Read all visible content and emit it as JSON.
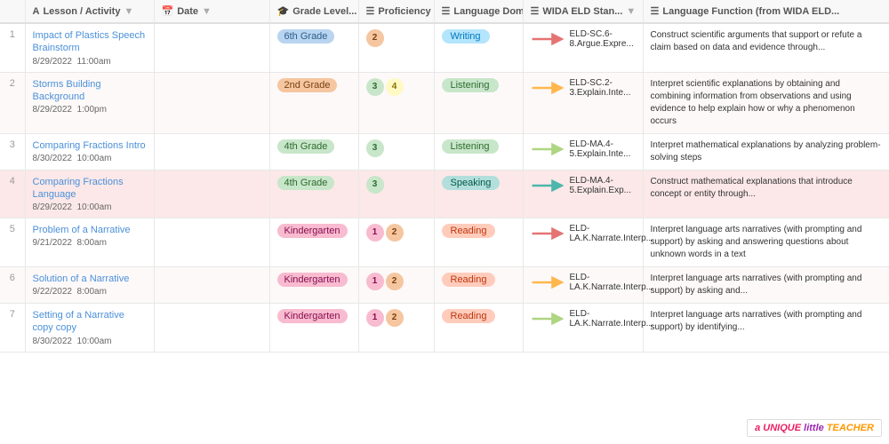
{
  "header": {
    "col_num": "#",
    "col_lesson": "Lesson / Activity",
    "col_date": "Date",
    "col_grade": "Grade Level...",
    "col_prof": "Proficiency Level(s)",
    "col_lang_domain": "Language Domain(s)",
    "col_wida": "WIDA ELD Stan...",
    "col_lang_func": "Language Function (from WIDA ELD..."
  },
  "rows": [
    {
      "num": "1",
      "lesson": "Impact of Plastics Speech Brainstorm",
      "date": "8/29/2022",
      "time": "11:00am",
      "grade": "6th Grade",
      "grade_class": "grade-6th",
      "prof": [
        "2"
      ],
      "prof_classes": [
        "prof-2"
      ],
      "lang_domain": "Writing",
      "lang_class": "lang-writing",
      "arrow_color": "#e57373",
      "wida": "ELD-SC.6-8.Argue.Expre...",
      "lang_func": "Construct scientific arguments that support or refute a claim based on data and evidence through...",
      "row_bg": ""
    },
    {
      "num": "2",
      "lesson": "Storms Building Background",
      "date": "8/29/2022",
      "time": "1:00pm",
      "grade": "2nd Grade",
      "grade_class": "grade-2nd",
      "prof": [
        "3",
        "4"
      ],
      "prof_classes": [
        "prof-3",
        "prof-4"
      ],
      "lang_domain": "Listening",
      "lang_class": "lang-listening",
      "arrow_color": "#ffb74d",
      "wida": "ELD-SC.2-3.Explain.Inte...",
      "lang_func": "Interpret scientific explanations by obtaining and combining information from observations and using evidence to help explain how or why a phenomenon occurs",
      "row_bg": ""
    },
    {
      "num": "3",
      "lesson": "Comparing Fractions Intro",
      "date": "8/30/2022",
      "time": "10:00am",
      "grade": "4th Grade",
      "grade_class": "grade-4th",
      "prof": [
        "3"
      ],
      "prof_classes": [
        "prof-3"
      ],
      "lang_domain": "Listening",
      "lang_class": "lang-listening",
      "arrow_color": "#aed581",
      "wida": "ELD-MA.4-5.Explain.Inte...",
      "lang_func": "Interpret mathematical explanations by analyzing problem-solving steps",
      "row_bg": ""
    },
    {
      "num": "4",
      "lesson": "Comparing Fractions Language",
      "date": "8/29/2022",
      "time": "10:00am",
      "grade": "4th Grade",
      "grade_class": "grade-4th",
      "prof": [
        "3"
      ],
      "prof_classes": [
        "prof-3"
      ],
      "lang_domain": "Speaking",
      "lang_class": "lang-speaking",
      "arrow_color": "#4db6ac",
      "wida": "ELD-MA.4-5.Explain.Exp...",
      "lang_func": "Construct mathematical explanations that introduce concept or entity through...",
      "row_bg": "highlight"
    },
    {
      "num": "5",
      "lesson": "Problem of a Narrative",
      "date": "9/21/2022",
      "time": "8:00am",
      "grade": "Kindergarten",
      "grade_class": "grade-k",
      "prof": [
        "1",
        "2"
      ],
      "prof_classes": [
        "prof-1",
        "prof-2"
      ],
      "lang_domain": "Reading",
      "lang_class": "lang-reading",
      "arrow_color": "#e57373",
      "wida": "ELD-LA.K.Narrate.Interp...",
      "lang_func": "Interpret language arts narratives (with prompting and support) by asking and answering questions about unknown words in a text",
      "row_bg": ""
    },
    {
      "num": "6",
      "lesson": "Solution of a Narrative",
      "date": "9/22/2022",
      "time": "8:00am",
      "grade": "Kindergarten",
      "grade_class": "grade-k",
      "prof": [
        "1",
        "2"
      ],
      "prof_classes": [
        "prof-1",
        "prof-2"
      ],
      "lang_domain": "Reading",
      "lang_class": "lang-reading",
      "arrow_color": "#ffb74d",
      "wida": "ELD-LA.K.Narrate.Interp...",
      "lang_func": "Interpret language arts narratives (with prompting and support) by asking and...",
      "row_bg": ""
    },
    {
      "num": "7",
      "lesson": "Setting of a Narrative copy copy",
      "date": "8/30/2022",
      "time": "10:00am",
      "grade": "Kindergarten",
      "grade_class": "grade-k",
      "prof": [
        "1",
        "2"
      ],
      "prof_classes": [
        "prof-1",
        "prof-2"
      ],
      "lang_domain": "Reading",
      "lang_class": "lang-reading",
      "arrow_color": "#aed581",
      "wida": "ELD-LA.K.Narrate.Interp...",
      "lang_func": "Interpret language arts narratives (with prompting and support) by identifying...",
      "row_bg": ""
    }
  ],
  "watermark": {
    "unique": "a UNIQUE",
    "little": "little",
    "teacher": "TEACHER"
  }
}
